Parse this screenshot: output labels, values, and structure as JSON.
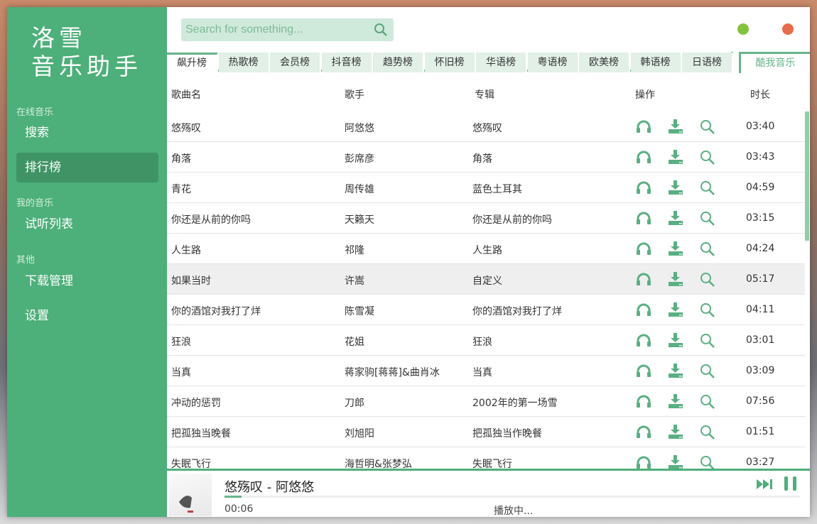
{
  "sidebar": {
    "logo_line1": "洛雪",
    "logo_line2": "音乐助手",
    "sections": [
      {
        "label": "在线音乐"
      },
      {
        "label": "我的音乐"
      },
      {
        "label": "其他"
      }
    ],
    "items": [
      {
        "label": "搜索"
      },
      {
        "label": "排行榜",
        "active": true
      },
      {
        "label": "试听列表"
      },
      {
        "label": "下载管理"
      },
      {
        "label": "设置"
      }
    ]
  },
  "search": {
    "placeholder": "Search for something...",
    "value": ""
  },
  "window_controls": {
    "minimize_color": "#85c23c",
    "close_color": "#e86b4b"
  },
  "tabs": [
    {
      "label": "飙升榜",
      "active": true
    },
    {
      "label": "热歌榜"
    },
    {
      "label": "会员榜"
    },
    {
      "label": "抖音榜"
    },
    {
      "label": "趋势榜"
    },
    {
      "label": "怀旧榜"
    },
    {
      "label": "华语榜"
    },
    {
      "label": "粤语榜"
    },
    {
      "label": "欧美榜"
    },
    {
      "label": "韩语榜"
    },
    {
      "label": "日语榜"
    }
  ],
  "source_tab": "酷我音乐",
  "table": {
    "headers": [
      "歌曲名",
      "歌手",
      "专辑",
      "操作",
      "时长"
    ],
    "rows": [
      [
        "悠殇叹",
        "阿悠悠",
        "悠殇叹",
        "03:40"
      ],
      [
        "角落",
        "彭席彦",
        "角落",
        "03:43"
      ],
      [
        "青花",
        "周传雄",
        "蓝色土耳其",
        "04:59"
      ],
      [
        "你还是从前的你吗",
        "天籁天",
        "你还是从前的你吗",
        "03:15"
      ],
      [
        "人生路",
        "祁隆",
        "人生路",
        "04:24"
      ],
      [
        "如果当时",
        "许嵩",
        "自定义",
        "05:17"
      ],
      [
        "你的酒馆对我打了烊",
        "陈雪凝",
        "你的酒馆对我打了烊",
        "04:11"
      ],
      [
        "狂浪",
        "花姐",
        "狂浪",
        "03:01"
      ],
      [
        "当真",
        "蒋家驹[蒋蒋]&曲肖冰",
        "当真",
        "03:09"
      ],
      [
        "冲动的惩罚",
        "刀郎",
        "2002年的第一场雪",
        "07:56"
      ],
      [
        "把孤独当晚餐",
        "刘旭阳",
        "把孤独当作晚餐",
        "01:51"
      ],
      [
        "失眠飞行",
        "海哲明&张梦弘",
        "失眠飞行",
        "03:27"
      ]
    ],
    "highlighted_row": 5,
    "row_actions": [
      "headphones-icon",
      "download-icon",
      "search-icon"
    ]
  },
  "player": {
    "title": "悠殇叹 - 阿悠悠",
    "time": "00:06",
    "status": "播放中...",
    "progress_percent": 3
  },
  "accent_color": "#4daf79"
}
